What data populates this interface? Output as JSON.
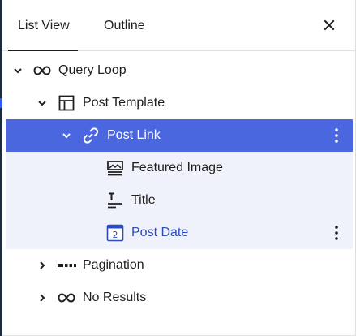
{
  "tabs": [
    {
      "label": "List View",
      "active": true
    },
    {
      "label": "Outline",
      "active": false
    }
  ],
  "tree": {
    "query_loop": {
      "label": "Query Loop",
      "icon": "loop-icon"
    },
    "post_template": {
      "label": "Post Template",
      "icon": "layout-icon"
    },
    "post_link": {
      "label": "Post Link",
      "icon": "link-icon"
    },
    "featured_image": {
      "label": "Featured Image",
      "icon": "image-icon"
    },
    "title": {
      "label": "Title",
      "icon": "title-icon"
    },
    "post_date": {
      "label": "Post Date",
      "icon": "calendar-icon",
      "calendar_day": "2"
    },
    "pagination": {
      "label": "Pagination",
      "icon": "pagination-icon"
    },
    "no_results": {
      "label": "No Results",
      "icon": "loop-icon"
    }
  },
  "colors": {
    "selected_bg": "#4b67df",
    "child_bg": "#f0f2fb",
    "accent": "#3858e9",
    "link_text": "#2c4bbd"
  }
}
